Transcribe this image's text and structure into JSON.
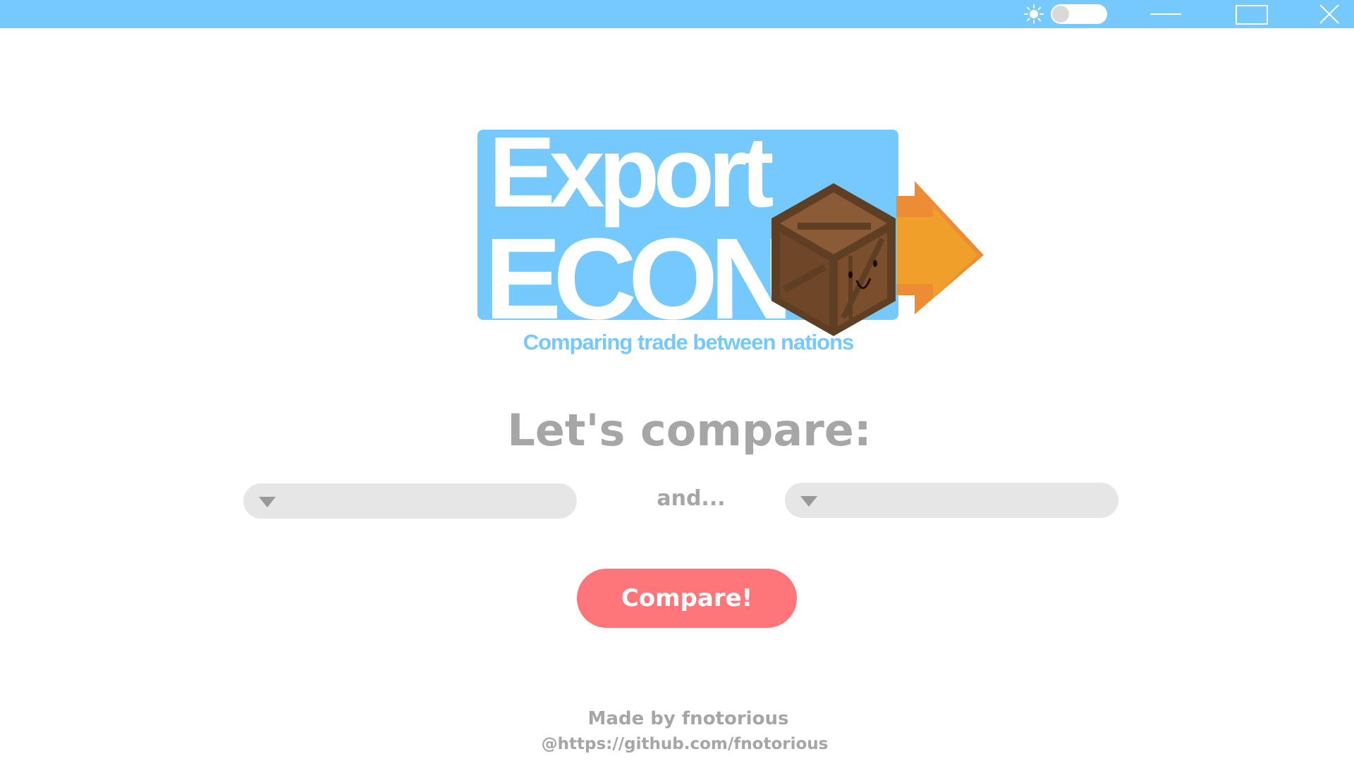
{
  "window": {
    "controls": {
      "theme_icon": "sun-icon",
      "theme_toggle": "off",
      "minimize_icon": "minimize-icon",
      "maximize_icon": "maximize-icon",
      "close_icon": "close-icon"
    }
  },
  "logo": {
    "word1": "Export",
    "word2": "ECON",
    "tagline": "Comparing trade between nations",
    "mascot_icon": "crate-icon",
    "arrow_icon": "arrow-right-icon"
  },
  "main": {
    "heading": "Let's compare:",
    "country_a": {
      "value": "",
      "icon": "caret-down-icon"
    },
    "separator": "and...",
    "country_b": {
      "value": "",
      "icon": "caret-down-icon"
    },
    "compare_label": "Compare!"
  },
  "footer": {
    "credit": "Made by fnotorious",
    "link": "@https://github.com/fnotorious"
  },
  "colors": {
    "accent_blue": "#76c9fd",
    "button_red": "#ff767a",
    "text_gray": "#a6a6a6",
    "select_bg": "#e6e6e6",
    "crate_brown": "#8b5a36",
    "arrow_orange": "#ec9a2d"
  }
}
